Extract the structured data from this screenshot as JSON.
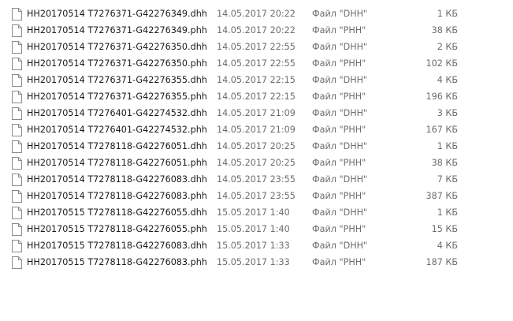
{
  "files": [
    {
      "name": "HH20170514 T7276371-G42276349.dhh",
      "modified": "14.05.2017 20:22",
      "type": "Файл \"DHH\"",
      "size": "1 КБ",
      "icon": "file-icon"
    },
    {
      "name": "HH20170514 T7276371-G42276349.phh",
      "modified": "14.05.2017 20:22",
      "type": "Файл \"PHH\"",
      "size": "38 КБ",
      "icon": "file-icon"
    },
    {
      "name": "HH20170514 T7276371-G42276350.dhh",
      "modified": "14.05.2017 22:55",
      "type": "Файл \"DHH\"",
      "size": "2 КБ",
      "icon": "file-icon"
    },
    {
      "name": "HH20170514 T7276371-G42276350.phh",
      "modified": "14.05.2017 22:55",
      "type": "Файл \"PHH\"",
      "size": "102 КБ",
      "icon": "file-icon"
    },
    {
      "name": "HH20170514 T7276371-G42276355.dhh",
      "modified": "14.05.2017 22:15",
      "type": "Файл \"DHH\"",
      "size": "4 КБ",
      "icon": "file-icon"
    },
    {
      "name": "HH20170514 T7276371-G42276355.phh",
      "modified": "14.05.2017 22:15",
      "type": "Файл \"PHH\"",
      "size": "196 КБ",
      "icon": "file-icon"
    },
    {
      "name": "HH20170514 T7276401-G42274532.dhh",
      "modified": "14.05.2017 21:09",
      "type": "Файл \"DHH\"",
      "size": "3 КБ",
      "icon": "file-icon"
    },
    {
      "name": "HH20170514 T7276401-G42274532.phh",
      "modified": "14.05.2017 21:09",
      "type": "Файл \"PHH\"",
      "size": "167 КБ",
      "icon": "file-icon"
    },
    {
      "name": "HH20170514 T7278118-G42276051.dhh",
      "modified": "14.05.2017 20:25",
      "type": "Файл \"DHH\"",
      "size": "1 КБ",
      "icon": "file-icon"
    },
    {
      "name": "HH20170514 T7278118-G42276051.phh",
      "modified": "14.05.2017 20:25",
      "type": "Файл \"PHH\"",
      "size": "38 КБ",
      "icon": "file-icon"
    },
    {
      "name": "HH20170514 T7278118-G42276083.dhh",
      "modified": "14.05.2017 23:55",
      "type": "Файл \"DHH\"",
      "size": "7 КБ",
      "icon": "file-icon"
    },
    {
      "name": "HH20170514 T7278118-G42276083.phh",
      "modified": "14.05.2017 23:55",
      "type": "Файл \"PHH\"",
      "size": "387 КБ",
      "icon": "file-icon"
    },
    {
      "name": "HH20170515 T7278118-G42276055.dhh",
      "modified": "15.05.2017 1:40",
      "type": "Файл \"DHH\"",
      "size": "1 КБ",
      "icon": "file-icon"
    },
    {
      "name": "HH20170515 T7278118-G42276055.phh",
      "modified": "15.05.2017 1:40",
      "type": "Файл \"PHH\"",
      "size": "15 КБ",
      "icon": "file-icon"
    },
    {
      "name": "HH20170515 T7278118-G42276083.dhh",
      "modified": "15.05.2017 1:33",
      "type": "Файл \"DHH\"",
      "size": "4 КБ",
      "icon": "file-icon"
    },
    {
      "name": "HH20170515 T7278118-G42276083.phh",
      "modified": "15.05.2017 1:33",
      "type": "Файл \"PHH\"",
      "size": "187 КБ",
      "icon": "file-icon"
    }
  ]
}
